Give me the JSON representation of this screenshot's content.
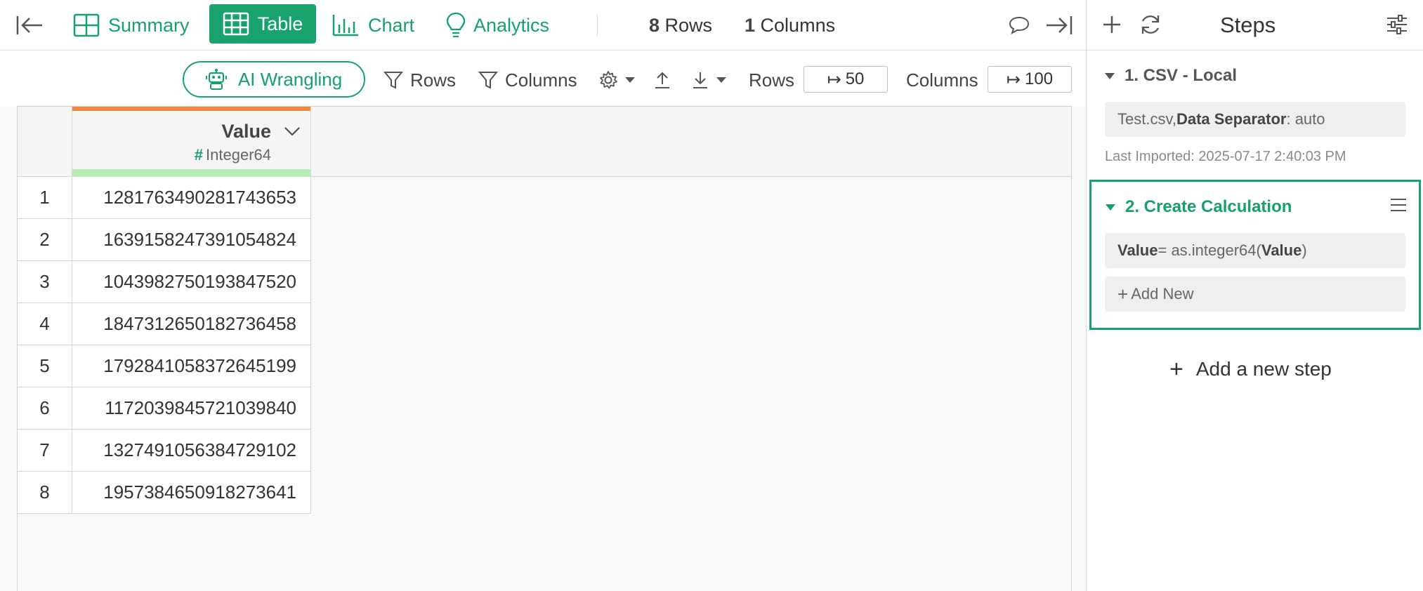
{
  "topbar": {
    "tabs": [
      {
        "label": "Summary",
        "icon": "grid-icon"
      },
      {
        "label": "Table",
        "icon": "table-icon",
        "active": true
      },
      {
        "label": "Chart",
        "icon": "bar-chart-icon"
      },
      {
        "label": "Analytics",
        "icon": "lightbulb-icon"
      }
    ],
    "rows_count": "8",
    "rows_label": "Rows",
    "cols_count": "1",
    "cols_label": "Columns"
  },
  "toolbar": {
    "ai_label": "AI Wrangling",
    "rows_filter": "Rows",
    "columns_filter": "Columns",
    "rows_label": "Rows",
    "rows_value": "50",
    "columns_label": "Columns",
    "columns_value": "100"
  },
  "table": {
    "column": {
      "name": "Value",
      "type_symbol": "#",
      "type": "Integer64"
    },
    "rows": [
      {
        "num": "1",
        "value": "1281763490281743653"
      },
      {
        "num": "2",
        "value": "1639158247391054824"
      },
      {
        "num": "3",
        "value": "1043982750193847520"
      },
      {
        "num": "4",
        "value": "1847312650182736458"
      },
      {
        "num": "5",
        "value": "1792841058372645199"
      },
      {
        "num": "6",
        "value": "1172039845721039840"
      },
      {
        "num": "7",
        "value": "1327491056384729102"
      },
      {
        "num": "8",
        "value": "1957384650918273641"
      }
    ]
  },
  "steps_panel": {
    "title": "Steps",
    "step1": {
      "title": "1. CSV - Local",
      "file": "Test.csv, ",
      "sep_key": "Data Separator",
      "sep_value": ": auto",
      "imported": "Last Imported: 2025-07-17 2:40:03 PM"
    },
    "step2": {
      "title": "2. Create Calculation",
      "expr_lhs": "Value",
      "expr_mid": " = as.integer64(",
      "expr_arg": "Value",
      "expr_end": ")",
      "add_new": "Add New"
    },
    "add_step": "Add a new step"
  },
  "colors": {
    "accent": "#17a36b",
    "header_orange": "#f08a3c",
    "header_green": "#b5ecb0"
  }
}
